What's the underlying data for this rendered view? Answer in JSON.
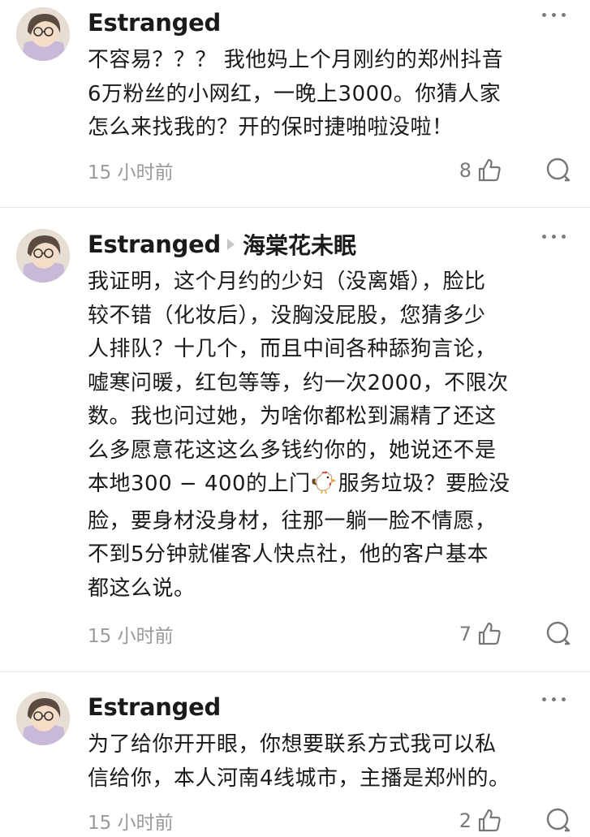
{
  "comments": [
    {
      "username": "Estranged",
      "reply_to": "",
      "text": "不容易？？？ 我他妈上个月刚约的郑州抖音\n6万粉丝的小网红，一晚上3000。你猜人家\n怎么来找我的？开的保时捷啪啦没啦！",
      "time": "15 小时前",
      "likes": "8"
    },
    {
      "username": "Estranged",
      "reply_to": "海棠花未眠",
      "text_part1": "我证明，这个月约的少妇（没离婚），脸比\n较不错（化妆后），没胸没屁股，您猜多少\n人排队？十几个，而且中间各种舔狗言论，\n嘘寒问暖，红包等等，约一次2000，不限次\n数。我也问过她，为啥你都松到漏精了还这\n么多愿意花这这么多钱约你的，她说还不是\n本地300 − 400的上门",
      "emoji": "rooster-emoji",
      "text_part2": "服务垃圾？要脸没\n脸，要身材没身材，往那一躺一脸不情愿，\n不到5分钟就催客人快点社，他的客户基本\n都这么说。",
      "time": "15 小时前",
      "likes": "7"
    },
    {
      "username": "Estranged",
      "reply_to": "",
      "text": "为了给你开开眼，你想要联系方式我可以私\n信给你，本人河南4线城市，主播是郑州的。",
      "time": "15 小时前",
      "likes": "2"
    }
  ],
  "colors": {
    "text": "#1a1a1a",
    "muted": "#9a9a9a",
    "divider": "#e4e4e4"
  },
  "icons": [
    "avatar-anime-girl",
    "more-dots-icon",
    "thumbs-up-icon",
    "comment-bubble-icon",
    "reply-arrow-icon"
  ]
}
